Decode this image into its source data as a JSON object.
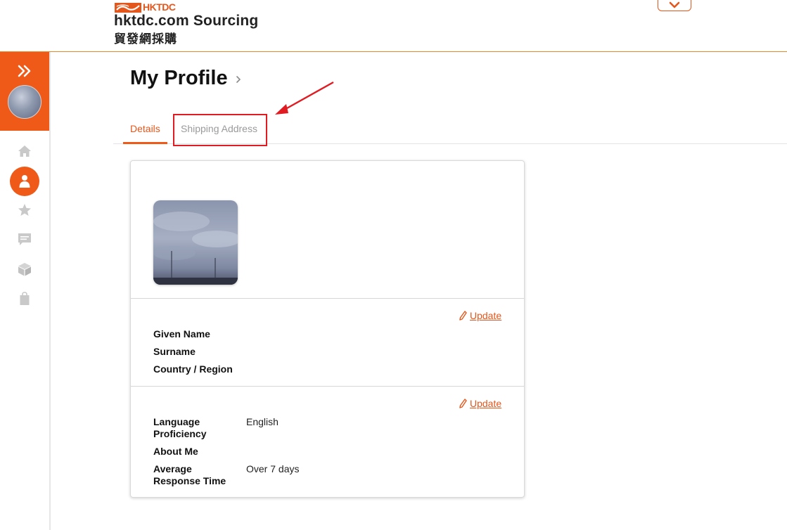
{
  "header": {
    "org_logo_text": "HKTDC",
    "site_title": "hktdc.com Sourcing",
    "site_title_cjk": "貿發網採購",
    "menu_toggle_icon": "chevron-down-icon"
  },
  "sidebar": {
    "expand_icon": "double-chevron-right-icon",
    "items": [
      {
        "icon": "home-icon",
        "active": false
      },
      {
        "icon": "user-icon",
        "active": true
      },
      {
        "icon": "star-icon",
        "active": false
      },
      {
        "icon": "message-icon",
        "active": false
      },
      {
        "icon": "box-icon",
        "active": false
      },
      {
        "icon": "shopping-bag-icon",
        "active": false
      }
    ]
  },
  "page": {
    "title": "My Profile"
  },
  "tabs": [
    {
      "label": "Details",
      "active": true
    },
    {
      "label": "Shipping Address",
      "active": false
    }
  ],
  "profile_card": {
    "sections": [
      {
        "update_label": "Update",
        "fields": [
          {
            "label": "Given Name",
            "value": ""
          },
          {
            "label": "Surname",
            "value": ""
          },
          {
            "label": "Country / Region",
            "value": ""
          }
        ]
      },
      {
        "update_label": "Update",
        "fields": [
          {
            "label": "Language Proficiency",
            "value": "English"
          },
          {
            "label": "About Me",
            "value": ""
          },
          {
            "label": "Average Response Time",
            "value": "Over 7 days"
          }
        ]
      }
    ]
  },
  "colors": {
    "brand_orange": "#ef5a19",
    "link_orange": "#e4571c",
    "annotation_red": "#e01b22"
  }
}
